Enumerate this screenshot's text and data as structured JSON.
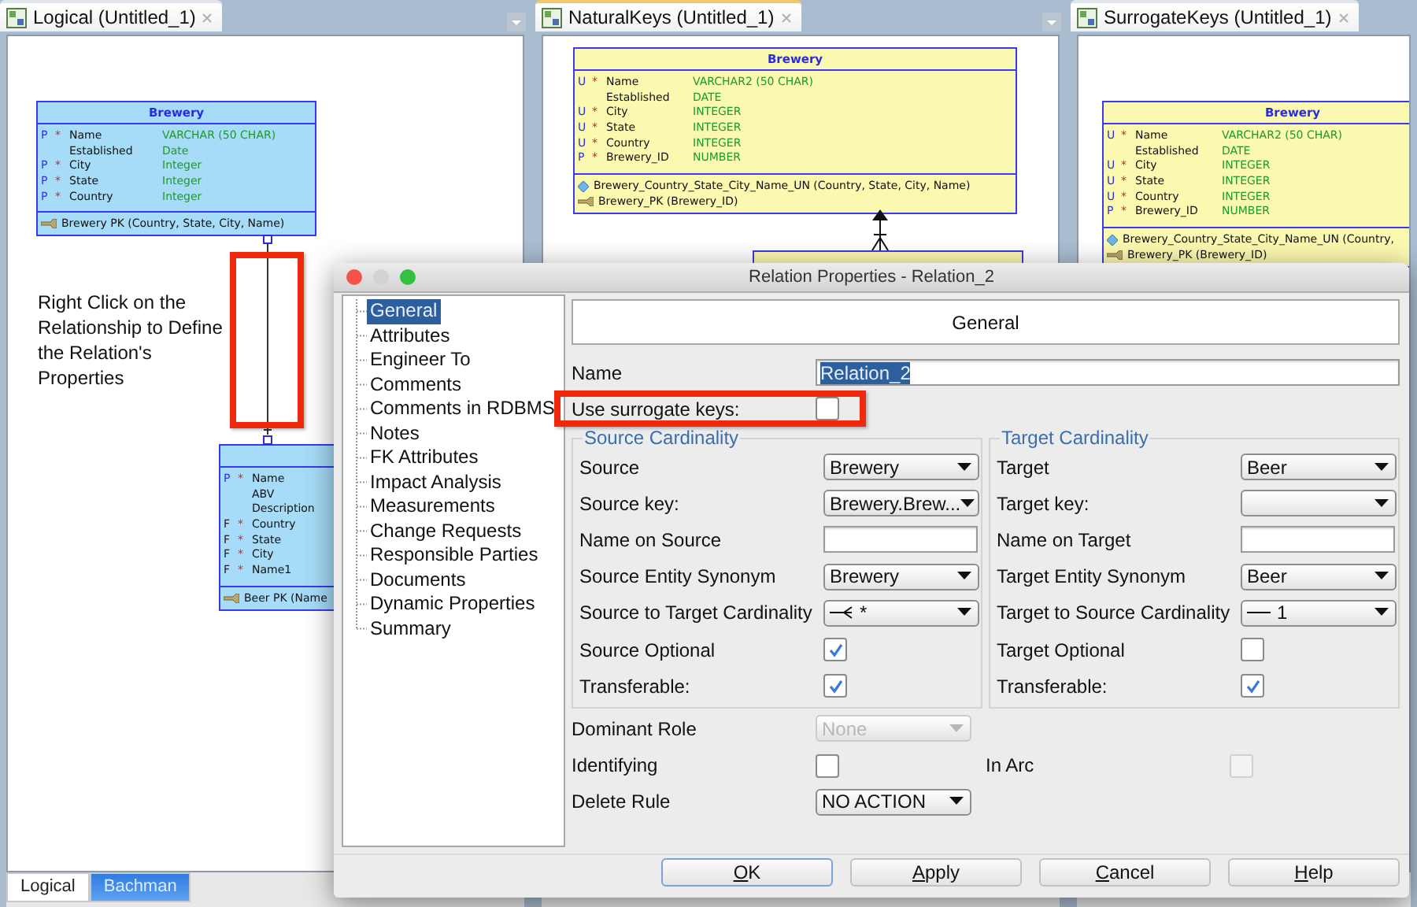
{
  "panes": [
    {
      "tab": "Logical (Untitled_1)",
      "selected": false,
      "kind": "logical",
      "note": "Right Click on the Relationship to Define the Relation's Properties",
      "entities": [
        {
          "title": "Brewery",
          "attributes": [
            {
              "flag": "P",
              "req": "*",
              "name": "Name",
              "type": "VARCHAR (50 CHAR)"
            },
            {
              "name": "Established",
              "type": "Date"
            },
            {
              "flag": "P",
              "req": "*",
              "name": "City",
              "type": "Integer"
            },
            {
              "flag": "P",
              "req": "*",
              "name": "State",
              "type": "Integer"
            },
            {
              "flag": "P",
              "req": "*",
              "name": "Country",
              "type": "Integer"
            }
          ],
          "keys": [
            {
              "kind": "pk",
              "text": "Brewery PK (Country, State, City, Name)"
            }
          ]
        },
        {
          "attributes": [
            {
              "flag": "P",
              "req": "*",
              "name": "Name"
            },
            {
              "name": "ABV"
            },
            {
              "name": "Description"
            },
            {
              "flag": "F",
              "req": "*",
              "name": "Country"
            },
            {
              "flag": "F",
              "req": "*",
              "name": "State"
            },
            {
              "flag": "F",
              "req": "*",
              "name": "City"
            },
            {
              "flag": "F",
              "req": "*",
              "name": "Name1"
            }
          ],
          "keys": [
            {
              "kind": "pk",
              "text": "Beer PK (Name"
            }
          ]
        }
      ],
      "bottom_tabs": [
        {
          "label": "Logical",
          "selected": false
        },
        {
          "label": "Bachman",
          "selected": true
        }
      ]
    },
    {
      "tab": "NaturalKeys (Untitled_1)",
      "selected": true,
      "kind": "relational",
      "entities": [
        {
          "title": "Brewery",
          "attributes": [
            {
              "flag": "U",
              "req": "*",
              "name": "Name",
              "type": "VARCHAR2 (50 CHAR)"
            },
            {
              "name": "Established",
              "type": "DATE"
            },
            {
              "flag": "U",
              "req": "*",
              "name": "City",
              "type": "INTEGER"
            },
            {
              "flag": "U",
              "req": "*",
              "name": "State",
              "type": "INTEGER"
            },
            {
              "flag": "U",
              "req": "*",
              "name": "Country",
              "type": "INTEGER"
            },
            {
              "flag": "P",
              "req": "*",
              "name": "Brewery_ID",
              "type": "NUMBER"
            }
          ],
          "keys": [
            {
              "kind": "unique",
              "text": "Brewery_Country_State_City_Name_UN (Country, State, City, Name)"
            },
            {
              "kind": "pk",
              "text": "Brewery_PK (Brewery_ID)"
            }
          ]
        }
      ]
    },
    {
      "tab": "SurrogateKeys (Untitled_1)",
      "selected": false,
      "kind": "relational",
      "entities": [
        {
          "title": "Brewery",
          "attributes": [
            {
              "flag": "U",
              "req": "*",
              "name": "Name",
              "type": "VARCHAR2 (50 CHAR)"
            },
            {
              "name": "Established",
              "type": "DATE"
            },
            {
              "flag": "U",
              "req": "*",
              "name": "City",
              "type": "INTEGER"
            },
            {
              "flag": "U",
              "req": "*",
              "name": "State",
              "type": "INTEGER"
            },
            {
              "flag": "U",
              "req": "*",
              "name": "Country",
              "type": "INTEGER"
            },
            {
              "flag": "P",
              "req": "*",
              "name": "Brewery_ID",
              "type": "NUMBER"
            }
          ],
          "keys": [
            {
              "kind": "unique",
              "text": "Brewery_Country_State_City_Name_UN (Country,"
            },
            {
              "kind": "pk",
              "text": "Brewery_PK (Brewery_ID)"
            }
          ]
        }
      ]
    }
  ],
  "dialog": {
    "title": "Relation Properties - Relation_2",
    "nav": [
      {
        "label": "General",
        "selected": true
      },
      {
        "label": "Attributes",
        "selected": false
      },
      {
        "label": "Engineer To",
        "selected": false
      },
      {
        "label": "Comments",
        "selected": false
      },
      {
        "label": "Comments in RDBMS",
        "selected": false
      },
      {
        "label": "Notes",
        "selected": false
      },
      {
        "label": "FK Attributes",
        "selected": false
      },
      {
        "label": "Impact Analysis",
        "selected": false
      },
      {
        "label": "Measurements",
        "selected": false
      },
      {
        "label": "Change Requests",
        "selected": false
      },
      {
        "label": "Responsible Parties",
        "selected": false
      },
      {
        "label": "Documents",
        "selected": false
      },
      {
        "label": "Dynamic Properties",
        "selected": false
      },
      {
        "label": "Summary",
        "selected": false
      }
    ],
    "header": "General",
    "name": {
      "label": "Name",
      "value": "Relation_2"
    },
    "surrogate": {
      "label": "Use surrogate keys:",
      "checked": false
    },
    "groups": [
      {
        "title": "Source Cardinality",
        "rows": [
          {
            "kind": "select",
            "label": "Source",
            "value": "Brewery"
          },
          {
            "kind": "select",
            "label": "Source key:",
            "value": "Brewery.Brew..."
          },
          {
            "kind": "text",
            "label": "Name on Source"
          },
          {
            "kind": "select",
            "label": "Source Entity Synonym",
            "value": "Brewery"
          },
          {
            "kind": "crowsfoot",
            "label": "Source to Target Cardinality",
            "value": "*"
          },
          {
            "kind": "checkbox",
            "label": "Source Optional",
            "checked": true
          },
          {
            "kind": "checkbox",
            "label": "Transferable:",
            "checked": true
          }
        ]
      },
      {
        "title": "Target Cardinality",
        "rows": [
          {
            "kind": "select",
            "label": "Target",
            "value": "Beer"
          },
          {
            "kind": "select",
            "label": "Target key:"
          },
          {
            "kind": "text",
            "label": "Name on Target"
          },
          {
            "kind": "select",
            "label": "Target Entity Synonym",
            "value": "Beer"
          },
          {
            "kind": "bar",
            "label": "Target to Source Cardinality",
            "value": "1"
          },
          {
            "kind": "checkbox",
            "label": "Target Optional",
            "checked": false
          },
          {
            "kind": "checkbox",
            "label": "Transferable:",
            "checked": true
          }
        ]
      }
    ],
    "fields": [
      {
        "left": {
          "kind": "select",
          "label": "Dominant Role",
          "value": "None",
          "disabled": true
        }
      },
      {
        "left": {
          "kind": "checkbox",
          "label": "Identifying",
          "checked": false,
          "disabled": false
        },
        "right": {
          "kind": "checkbox",
          "label": "In Arc",
          "checked": false,
          "disabled": true
        }
      },
      {
        "left": {
          "kind": "select",
          "label": "Delete Rule",
          "value": "NO ACTION",
          "disabled": false
        }
      }
    ],
    "buttons": [
      {
        "label": "OK",
        "default": true
      },
      {
        "label": "Apply",
        "default": false
      },
      {
        "label": "Cancel",
        "default": false
      },
      {
        "label": "Help",
        "default": false
      }
    ]
  }
}
